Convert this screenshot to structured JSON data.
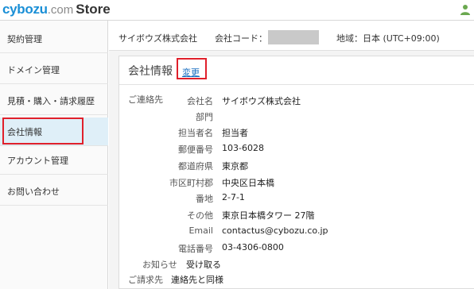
{
  "header": {
    "logo_brand": "cybozu",
    "logo_dotcom": ".com",
    "logo_store": "Store",
    "brand_color": "#1a8fd6",
    "user_icon": "user-icon"
  },
  "sidebar": {
    "items": [
      {
        "label": "契約管理"
      },
      {
        "label": "ドメイン管理"
      },
      {
        "label": "見積・購入・請求履歴"
      },
      {
        "label": "会社情報"
      },
      {
        "label": "アカウント管理"
      },
      {
        "label": "お問い合わせ"
      }
    ],
    "active_index": 3
  },
  "infobar": {
    "company": "サイボウズ株式会社",
    "company_code_label": "会社コード：",
    "region": "地域：日本 (UTC+09:00)"
  },
  "panel": {
    "title": "会社情報",
    "edit_label": "変更",
    "contact_section": "ご連絡先",
    "rows": [
      {
        "label": "会社名",
        "value": "サイボウズ株式会社"
      },
      {
        "label": "部門",
        "value": ""
      },
      {
        "label": "担当者名",
        "value": "担当者"
      },
      {
        "label": "郵便番号",
        "value": "103-6028"
      },
      {
        "label": "都道府県",
        "value": "東京都"
      },
      {
        "label": "市区町村郡",
        "value": "中央区日本橋"
      },
      {
        "label": "番地",
        "value": "2-7-1"
      },
      {
        "label": "その他",
        "value": "東京日本橋タワー 27階"
      },
      {
        "label": "Email",
        "value": "contactus@cybozu.co.jp"
      },
      {
        "label": "電話番号",
        "value": "03-4306-0800"
      }
    ],
    "notice_label": "お知らせ",
    "notice_value": "受け取る",
    "billing_label": "ご請求先",
    "billing_value": "連絡先と同様"
  },
  "colors": {
    "highlight": "#e0202b",
    "link": "#1a6fc0",
    "active_bg": "#dfeff8"
  }
}
